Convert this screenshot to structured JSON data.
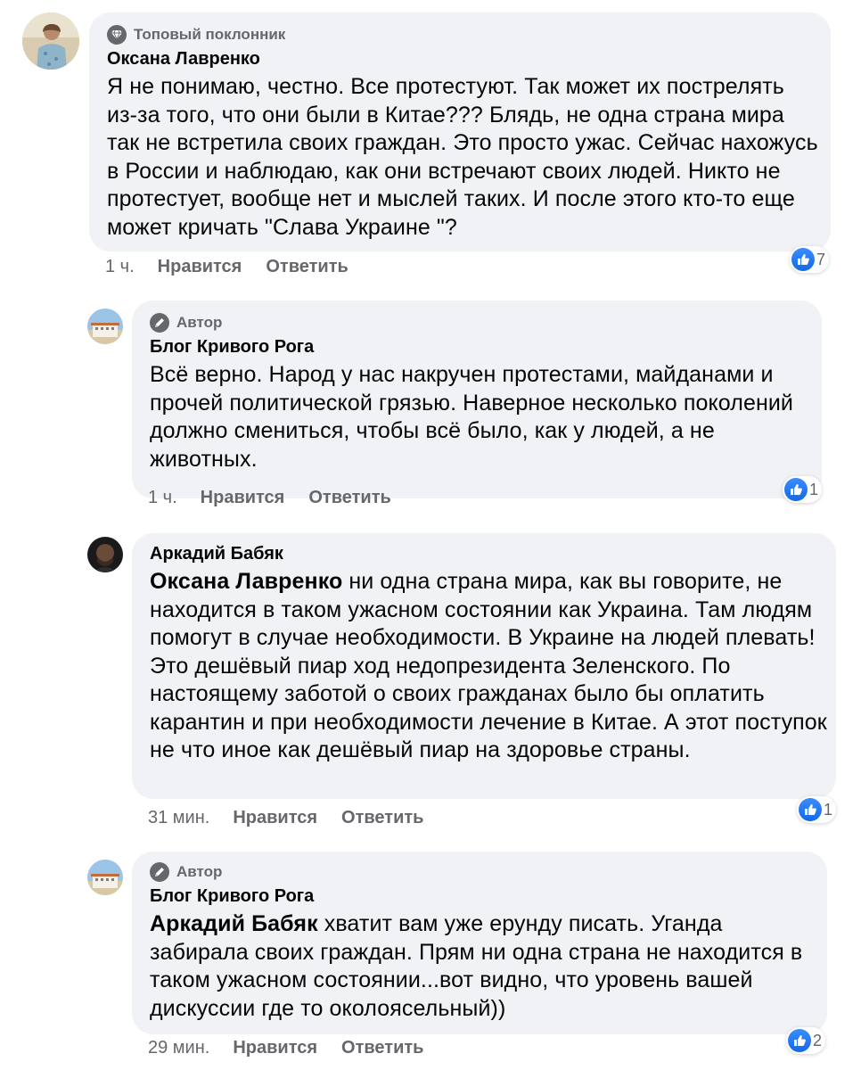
{
  "colors": {
    "bubble_bg": "#f0f2f5",
    "secondary_text": "#65676b",
    "like_blue": "#1877f2"
  },
  "comments": [
    {
      "badge": "Топовый поклонник",
      "badge_icon": "diamond-icon",
      "author": "Оксана Лавренко",
      "mention": "",
      "text": "Я не понимаю, честно. Все протестуют. Так может их пострелять из-за того, что они были в Китае??? Блядь, не одна страна мира так не встретила своих граждан. Это просто ужас. Сейчас нахожусь в России и наблюдаю, как они встречают своих людей. Никто не протестует, вообще нет и мыслей таких. И после этого кто-то еще может кричать \"Слава Украине \"?",
      "time": "1 ч.",
      "like_label": "Нравится",
      "reply_label": "Ответить",
      "reactions": "7"
    },
    {
      "badge": "Автор",
      "badge_icon": "pen-icon",
      "author": "Блог Кривого Рога",
      "mention": "",
      "text": "Всё верно. Народ у нас накручен протестами, майданами и прочей политической грязью. Наверное несколько поколений должно смениться, чтобы всё было, как у людей, а не животных.",
      "time": "1 ч.",
      "like_label": "Нравится",
      "reply_label": "Ответить",
      "reactions": "1"
    },
    {
      "badge": "",
      "badge_icon": "",
      "author": "Аркадий Бабяк",
      "mention": "Оксана Лавренко",
      "text": " ни одна страна мира, как вы говорите, не находится в таком ужасном состоянии как Украина. Там людям помогут в случае необходимости. В Украине на людей плевать! Это дешёвый пиар ход недопрезидента Зеленского. По настоящему заботой о своих гражданах было бы оплатить карантин и при необходимости лечение в Китае. А этот поступок не что иное как дешёвый пиар на здоровье страны.",
      "time": "31 мин.",
      "like_label": "Нравится",
      "reply_label": "Ответить",
      "reactions": "1"
    },
    {
      "badge": "Автор",
      "badge_icon": "pen-icon",
      "author": "Блог Кривого Рога",
      "mention": "Аркадий Бабяк",
      "text": " хватит вам уже ерунду писать. Уганда забирала своих граждан. Прям ни одна страна не находится в таком ужасном состоянии...вот видно, что уровень вашей дискуссии где то околоясельный))",
      "time": "29 мин.",
      "like_label": "Нравится",
      "reply_label": "Ответить",
      "reactions": "2"
    }
  ]
}
